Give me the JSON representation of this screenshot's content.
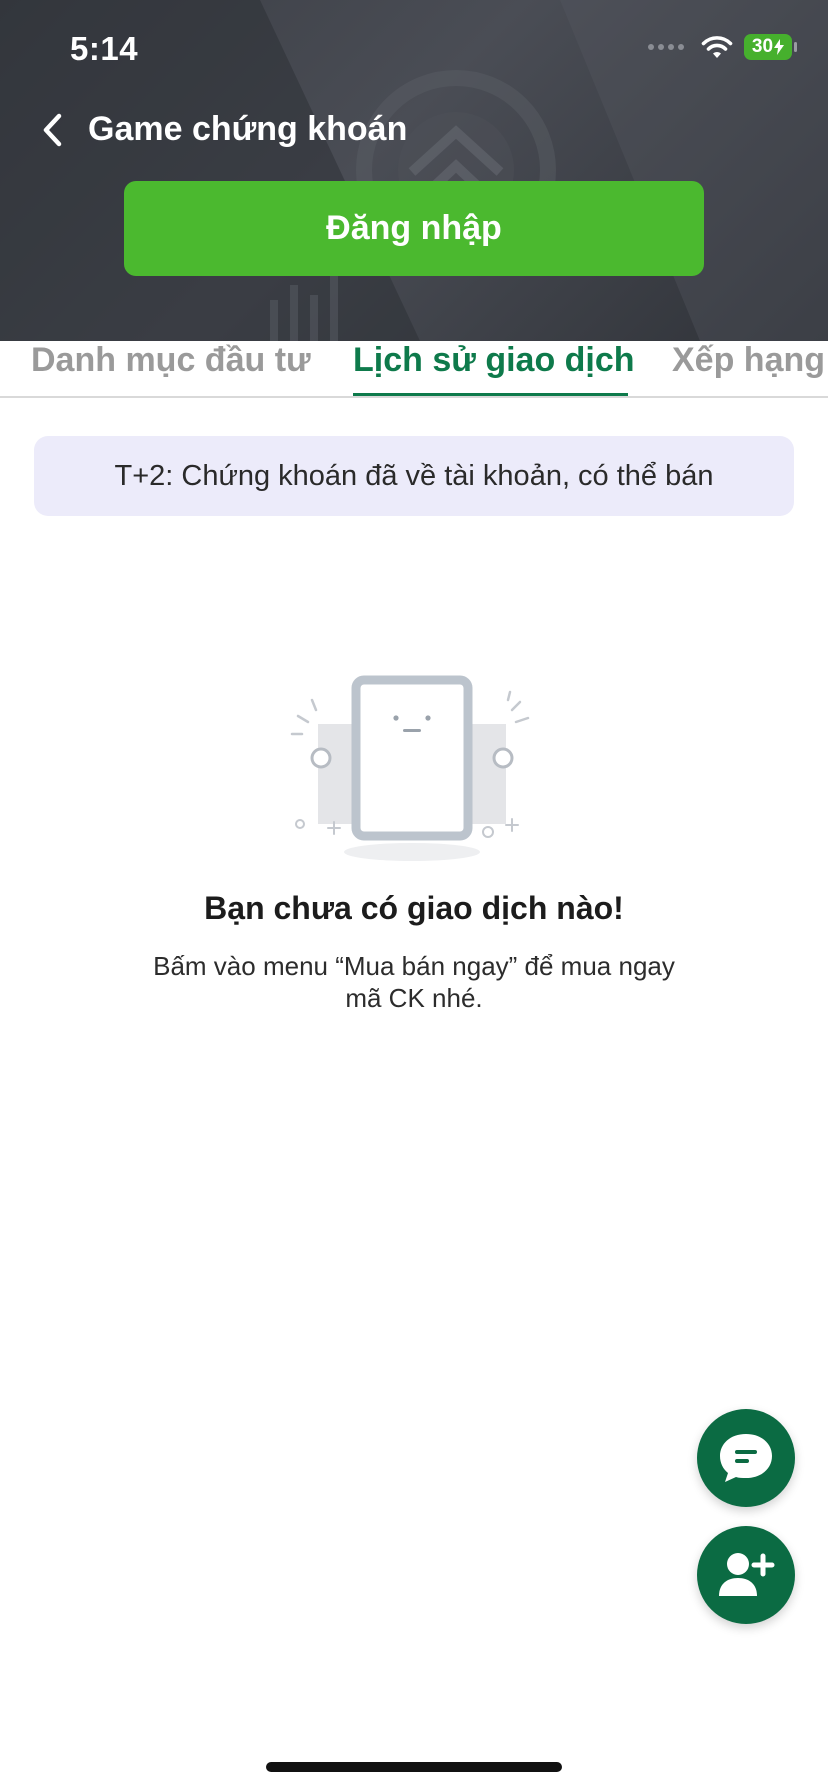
{
  "status_bar": {
    "time": "5:14",
    "battery": "30"
  },
  "header": {
    "title": "Game chứng khoán",
    "login_label": "Đăng nhập"
  },
  "tabs": [
    {
      "label": "Danh mục đầu tư",
      "active": false
    },
    {
      "label": "Lịch sử giao dịch",
      "active": true
    },
    {
      "label": "Xếp hạng",
      "active": false
    }
  ],
  "info_banner": "T+2: Chứng khoán đã về tài khoản, có thể bán",
  "empty_state": {
    "title": "Bạn chưa có giao dịch nào!",
    "description_line1": "Bấm vào menu “Mua bán ngay” để mua ngay",
    "description_line2": "mã CK nhé."
  },
  "colors": {
    "accent_green": "#0b6b43",
    "login_green": "#4bb92f",
    "active_tab": "#0e7a4b",
    "banner_bg": "#ecebfa"
  },
  "icons": {
    "back": "chevron-left-icon",
    "wifi": "wifi-icon",
    "battery": "battery-icon",
    "chat": "chat-bubble-icon",
    "add_user": "add-user-icon",
    "empty": "empty-tablet-illustration"
  }
}
